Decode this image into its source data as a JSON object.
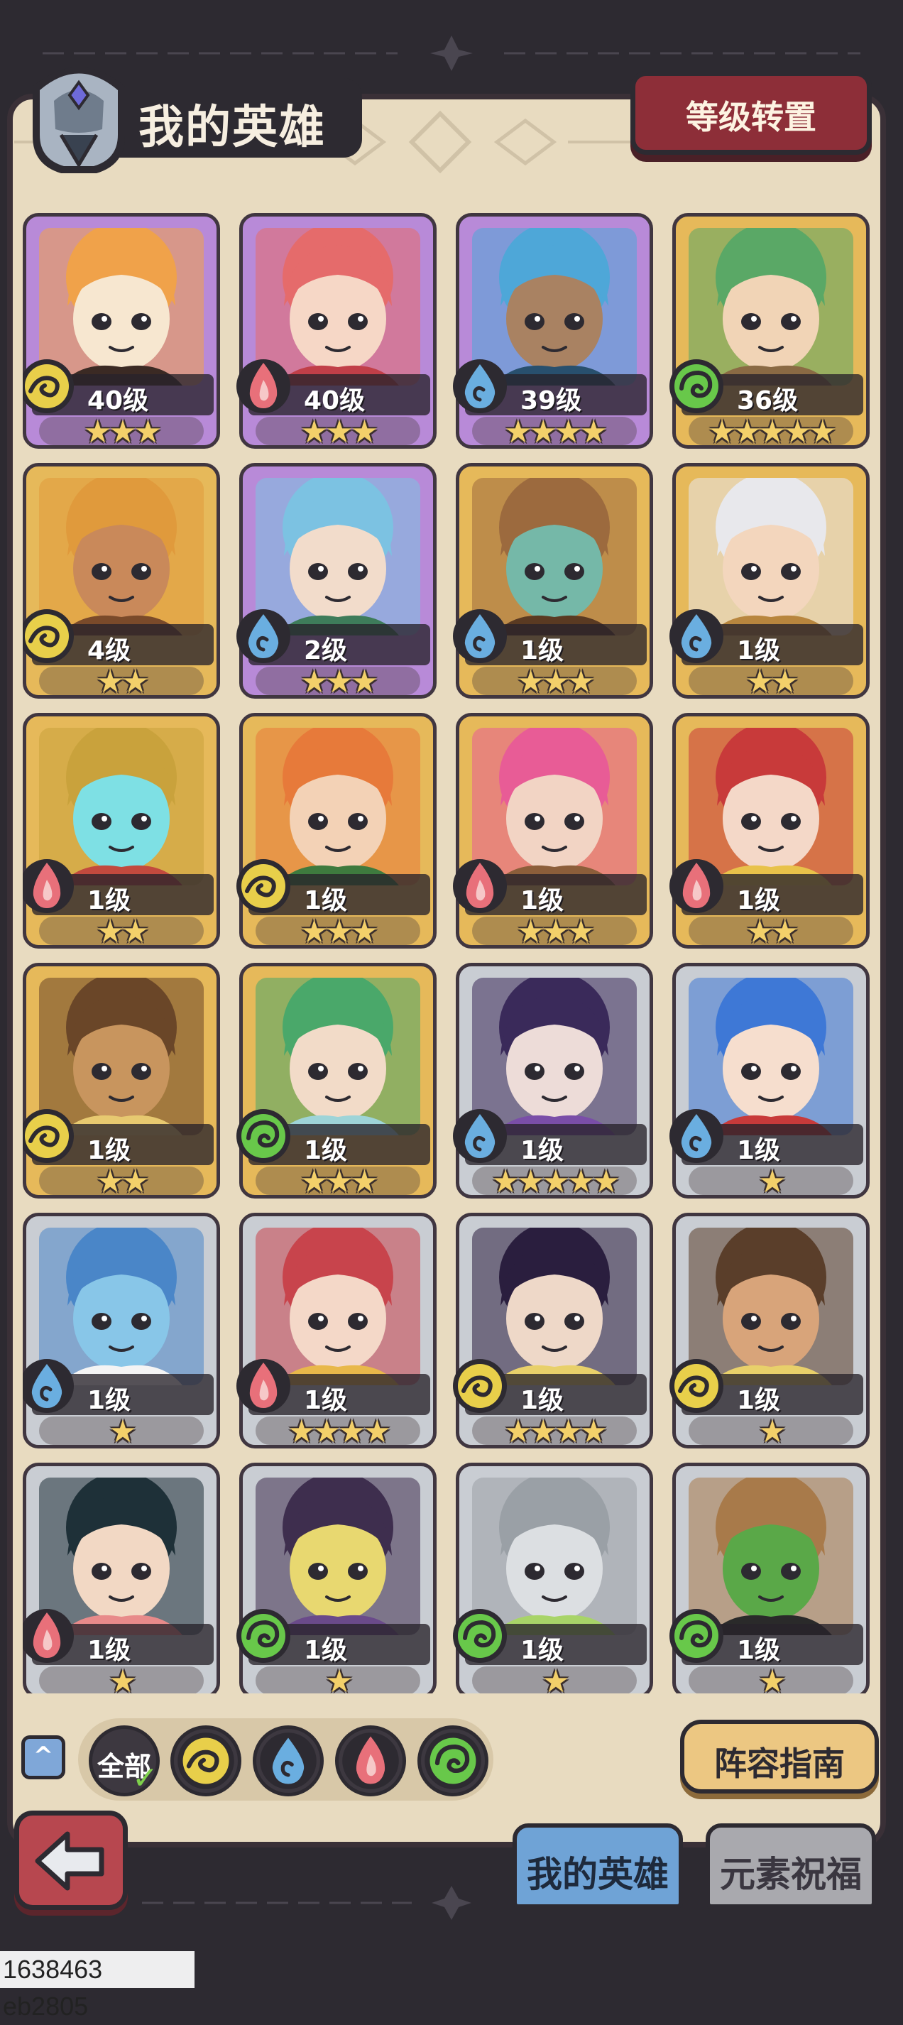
{
  "header": {
    "title": "我的英雄",
    "level_reset_label": "等级转置"
  },
  "heroes": [
    {
      "level": "40级",
      "stars": 3,
      "element": "earth",
      "rarity": "purple",
      "palette": [
        "#f0a24a",
        "#f7e7d0",
        "#3b2a24"
      ]
    },
    {
      "level": "40级",
      "stars": 3,
      "element": "fire",
      "rarity": "purple",
      "palette": [
        "#e56b6b",
        "#f6d7c6",
        "#c13f48"
      ]
    },
    {
      "level": "39级",
      "stars": 4,
      "element": "water",
      "rarity": "purple",
      "palette": [
        "#4ea7d8",
        "#a98262",
        "#28506e"
      ]
    },
    {
      "level": "36级",
      "stars": 5,
      "element": "wind",
      "rarity": "gold",
      "palette": [
        "#5aa866",
        "#f1d4b6",
        "#8a6a44"
      ]
    },
    {
      "level": "4级",
      "stars": 2,
      "element": "earth",
      "rarity": "gold",
      "palette": [
        "#e09a3c",
        "#c9895a",
        "#7a4a2a"
      ]
    },
    {
      "level": "2级",
      "stars": 3,
      "element": "water",
      "rarity": "purple",
      "palette": [
        "#7cc2e2",
        "#f2dccb",
        "#3e7c5a"
      ]
    },
    {
      "level": "1级",
      "stars": 3,
      "element": "water",
      "rarity": "gold",
      "palette": [
        "#9c6a3e",
        "#75b8a8",
        "#5a3a22"
      ]
    },
    {
      "level": "1级",
      "stars": 2,
      "element": "water",
      "rarity": "gold",
      "palette": [
        "#e8e8ec",
        "#f3d6bd",
        "#b8863e"
      ]
    },
    {
      "level": "1级",
      "stars": 2,
      "element": "fire",
      "rarity": "gold",
      "palette": [
        "#c9a23c",
        "#7ee0e4",
        "#c24a3e"
      ]
    },
    {
      "level": "1级",
      "stars": 3,
      "element": "earth",
      "rarity": "gold",
      "palette": [
        "#e77a3a",
        "#f3d2b6",
        "#3e7a3e"
      ]
    },
    {
      "level": "1级",
      "stars": 3,
      "element": "fire",
      "rarity": "gold",
      "palette": [
        "#e85c96",
        "#f2d4c4",
        "#8c5e3a"
      ]
    },
    {
      "level": "1级",
      "stars": 2,
      "element": "fire",
      "rarity": "gold",
      "palette": [
        "#c83a3a",
        "#f4d8c8",
        "#e8c24a"
      ]
    },
    {
      "level": "1级",
      "stars": 2,
      "element": "earth",
      "rarity": "gold",
      "palette": [
        "#6a4628",
        "#c8955e",
        "#e7c970"
      ]
    },
    {
      "level": "1级",
      "stars": 3,
      "element": "wind",
      "rarity": "gold",
      "palette": [
        "#4aa86a",
        "#f2dbc8",
        "#9ed4d8"
      ]
    },
    {
      "level": "1级",
      "stars": 5,
      "element": "water",
      "rarity": "silver",
      "palette": [
        "#3a2a5a",
        "#eddcd8",
        "#7a4ea8"
      ]
    },
    {
      "level": "1级",
      "stars": 1,
      "element": "water",
      "rarity": "silver",
      "palette": [
        "#3e78d6",
        "#f6dece",
        "#c83a3a"
      ]
    },
    {
      "level": "1级",
      "stars": 1,
      "element": "water",
      "rarity": "silver",
      "palette": [
        "#4a86c8",
        "#88c6e8",
        "#f4f4f4"
      ]
    },
    {
      "level": "1级",
      "stars": 4,
      "element": "fire",
      "rarity": "silver",
      "palette": [
        "#c8444c",
        "#f4d8c8",
        "#e8b84a"
      ]
    },
    {
      "level": "1级",
      "stars": 4,
      "element": "earth",
      "rarity": "silver",
      "palette": [
        "#2a1e3e",
        "#eed8c8",
        "#e8d06a"
      ]
    },
    {
      "level": "1级",
      "stars": 1,
      "element": "earth",
      "rarity": "silver",
      "palette": [
        "#5a3e2a",
        "#d8a47a",
        "#e8d06a"
      ]
    },
    {
      "level": "1级",
      "stars": 1,
      "element": "fire",
      "rarity": "silver",
      "palette": [
        "#1e3038",
        "#f2d8c4",
        "#e88a8a"
      ]
    },
    {
      "level": "1级",
      "stars": 1,
      "element": "wind",
      "rarity": "silver",
      "palette": [
        "#3e2e4e",
        "#e8d870",
        "#6a4a8a"
      ]
    },
    {
      "level": "1级",
      "stars": 1,
      "element": "wind",
      "rarity": "silver",
      "palette": [
        "#9aa0a6",
        "#dcdfe2",
        "#a8d468"
      ]
    },
    {
      "level": "1级",
      "stars": 1,
      "element": "wind",
      "rarity": "silver",
      "palette": [
        "#a87a4a",
        "#5aa848",
        "#2a2a2a"
      ]
    }
  ],
  "filters": {
    "collapse_icon": "chevron-up-icon",
    "all_label": "全部",
    "elements": [
      "earth",
      "water",
      "fire",
      "wind"
    ]
  },
  "element_colors": {
    "earth": "#e8cf4a",
    "water": "#6aaee0",
    "fire": "#e8707a",
    "wind": "#68c84a"
  },
  "rarity_colors": {
    "purple": "#b88ad8",
    "gold": "#e6b95a",
    "silver": "#c9cdd3"
  },
  "buttons": {
    "lineup_guide_label": "阵容指南"
  },
  "tabs": [
    {
      "label": "我的英雄",
      "active": true
    },
    {
      "label": "元素祝福",
      "active": false
    }
  ],
  "footer": {
    "build_id": "1638463 eb2805"
  }
}
